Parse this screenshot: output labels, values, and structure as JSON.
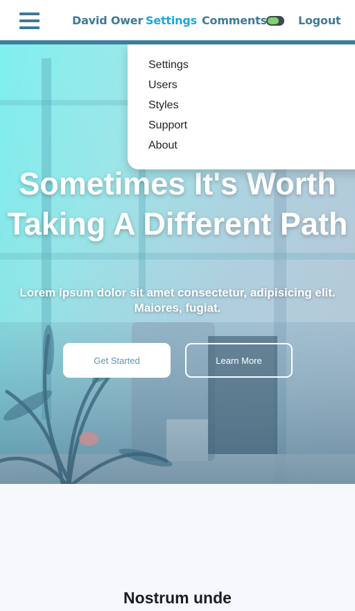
{
  "header": {
    "user_name": "David Ower",
    "nav": {
      "settings": "Settings",
      "comments": "Comments",
      "logout": "Logout"
    },
    "comments_toggle": "on",
    "accent_color": "#3f7a97",
    "active_color": "#1aa7dc"
  },
  "dropdown": {
    "items": [
      "Settings",
      "Users",
      "Styles",
      "Support",
      "About"
    ]
  },
  "hero": {
    "title": "Sometimes It's Worth Taking A Different Path",
    "subtitle": "Lorem ipsum dolor sit amet consectetur, adipisicing elit. Maiores, fugiat.",
    "primary_button": "Get Started",
    "secondary_button": "Learn More"
  },
  "section": {
    "title": "Nostrum unde"
  }
}
